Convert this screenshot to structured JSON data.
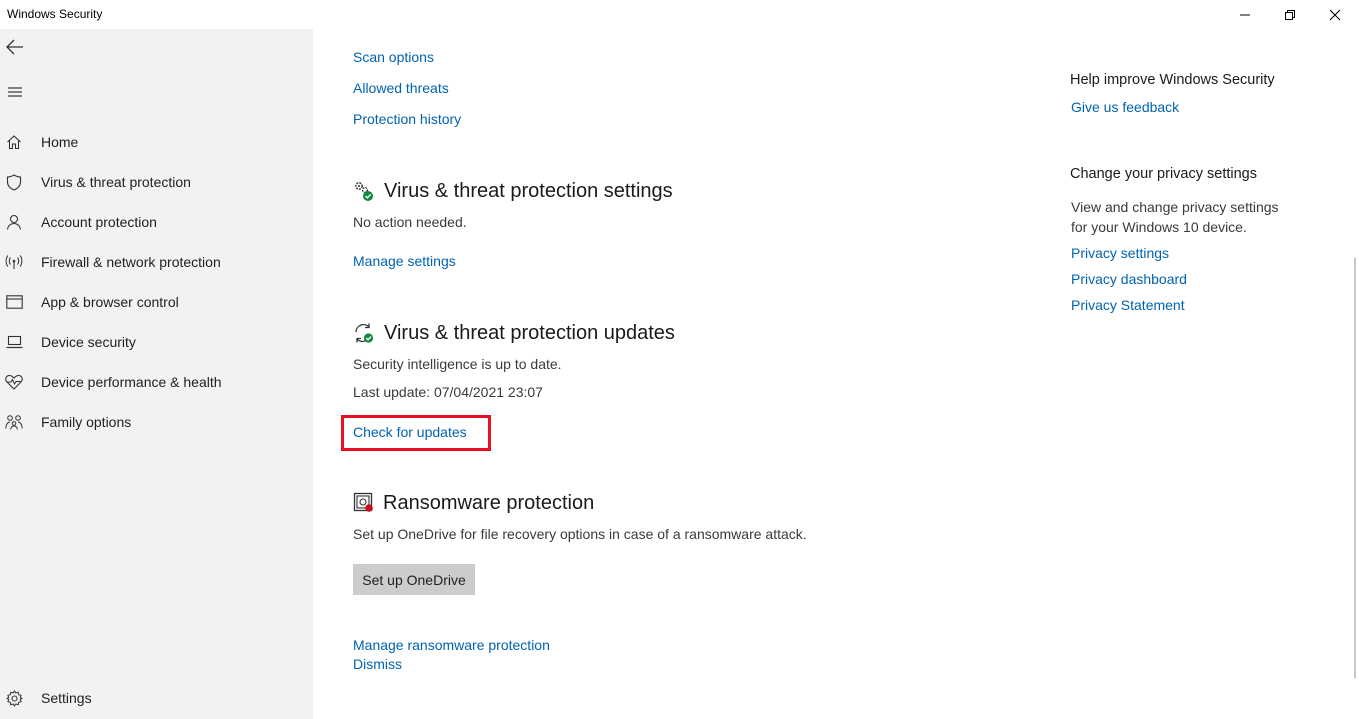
{
  "window": {
    "title": "Windows Security",
    "minimize_icon": "minimize-icon",
    "maximize_icon": "restore-icon",
    "close_icon": "close-icon"
  },
  "sidebar": {
    "back_icon": "back-arrow-icon",
    "menu_icon": "hamburger-menu-icon",
    "items": [
      {
        "label": "Home",
        "icon": "home-icon"
      },
      {
        "label": "Virus & threat protection",
        "icon": "shield-icon"
      },
      {
        "label": "Account protection",
        "icon": "person-icon"
      },
      {
        "label": "Firewall & network protection",
        "icon": "wireless-icon"
      },
      {
        "label": "App & browser control",
        "icon": "browser-window-icon"
      },
      {
        "label": "Device security",
        "icon": "laptop-icon"
      },
      {
        "label": "Device performance & health",
        "icon": "heart-pulse-icon"
      },
      {
        "label": "Family options",
        "icon": "family-icon"
      }
    ],
    "settings": {
      "label": "Settings",
      "icon": "gear-icon"
    }
  },
  "main": {
    "top_links": [
      "Scan options",
      "Allowed threats",
      "Protection history"
    ],
    "settings_section": {
      "title": "Virus & threat protection settings",
      "icon": "gears-check-icon",
      "status": "No action needed.",
      "link": "Manage settings"
    },
    "updates_section": {
      "title": "Virus & threat protection updates",
      "icon": "refresh-check-icon",
      "status": "Security intelligence is up to date.",
      "last_update": "Last update: 07/04/2021 23:07",
      "link": "Check for updates"
    },
    "ransomware_section": {
      "title": "Ransomware protection",
      "icon": "ransomware-folder-icon",
      "description": "Set up OneDrive for file recovery options in case of a ransomware attack.",
      "button": "Set up OneDrive",
      "manage_link": "Manage ransomware protection",
      "dismiss_link": "Dismiss"
    }
  },
  "right_panel": {
    "help": {
      "heading": "Help improve Windows Security",
      "link": "Give us feedback"
    },
    "privacy": {
      "heading": "Change your privacy settings",
      "desc_line1": "View and change privacy settings",
      "desc_line2": "for your Windows 10 device.",
      "links": [
        "Privacy settings",
        "Privacy dashboard",
        "Privacy Statement"
      ]
    }
  },
  "colors": {
    "link": "#0063b1",
    "sidebar_bg": "#f2f2f2",
    "highlight": "#e81123",
    "check_green": "#10893e"
  }
}
